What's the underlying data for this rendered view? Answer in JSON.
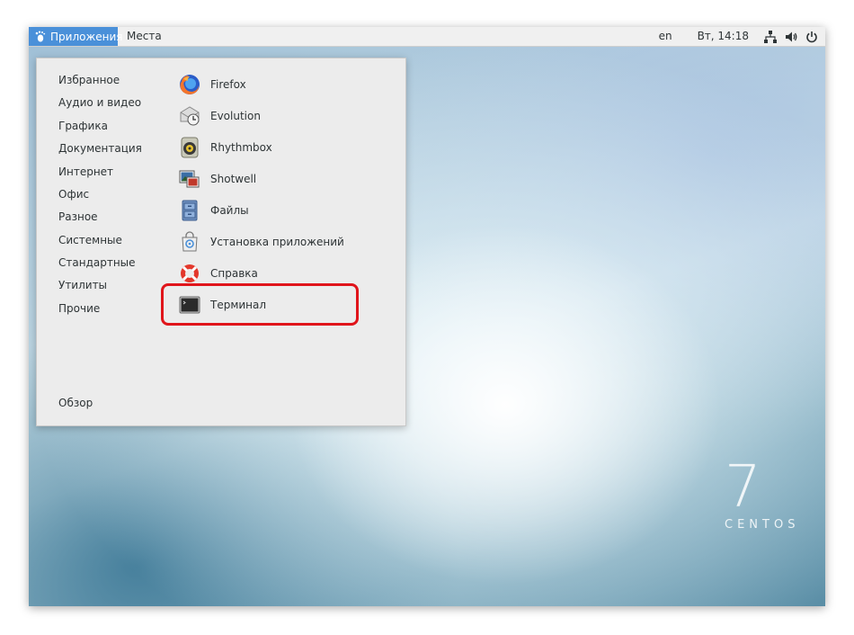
{
  "topbar": {
    "applications_label": "Приложения",
    "places_label": "Места",
    "language": "en",
    "clock": "Вт, 14:18"
  },
  "menu": {
    "categories": [
      {
        "label": "Избранное"
      },
      {
        "label": "Аудио и видео"
      },
      {
        "label": "Графика"
      },
      {
        "label": "Документация"
      },
      {
        "label": "Интернет"
      },
      {
        "label": "Офис"
      },
      {
        "label": "Разное"
      },
      {
        "label": "Системные"
      },
      {
        "label": "Стандартные"
      },
      {
        "label": "Утилиты"
      },
      {
        "label": "Прочие"
      }
    ],
    "overview_label": "Обзор",
    "apps": [
      {
        "label": "Firefox",
        "icon": "firefox-icon"
      },
      {
        "label": "Evolution",
        "icon": "evolution-icon"
      },
      {
        "label": "Rhythmbox",
        "icon": "rhythmbox-icon"
      },
      {
        "label": "Shotwell",
        "icon": "shotwell-icon"
      },
      {
        "label": "Файлы",
        "icon": "files-icon"
      },
      {
        "label": "Установка приложений",
        "icon": "software-icon"
      },
      {
        "label": "Справка",
        "icon": "help-icon"
      },
      {
        "label": "Терминал",
        "icon": "terminal-icon"
      }
    ],
    "highlight_color": "#e0151b"
  },
  "branding": {
    "version": "7",
    "name": "CENTOS"
  }
}
